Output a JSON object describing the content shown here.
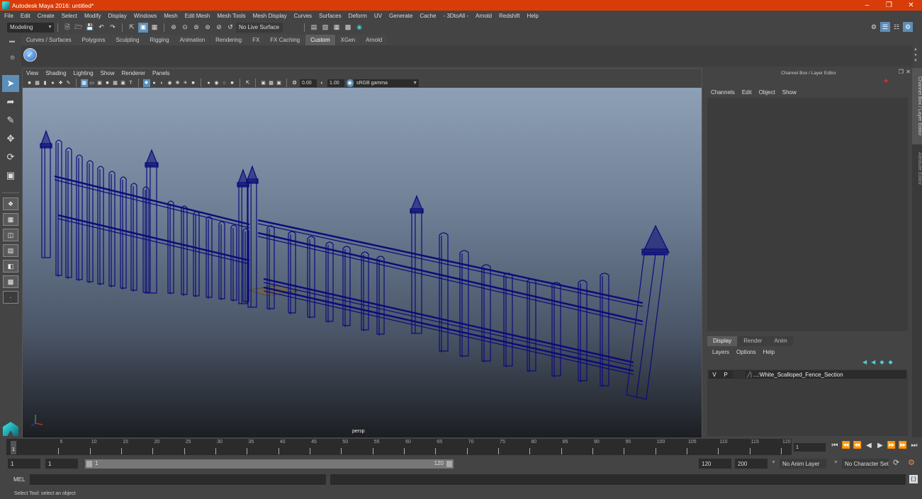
{
  "window": {
    "title": "Autodesk Maya 2016: untitled*",
    "controls": [
      "minimize",
      "maximize",
      "close"
    ]
  },
  "menubar": [
    "File",
    "Edit",
    "Create",
    "Select",
    "Modify",
    "Display",
    "Windows",
    "Mesh",
    "Edit Mesh",
    "Mesh Tools",
    "Mesh Display",
    "Curves",
    "Surfaces",
    "Deform",
    "UV",
    "Generate",
    "Cache",
    "- 3DtoAll -",
    "Arnold",
    "Redshift",
    "Help"
  ],
  "statusline": {
    "menuset": "Modeling",
    "live_surface": "No Live Surface"
  },
  "shelf": {
    "tabs": [
      "Curves / Surfaces",
      "Polygons",
      "Sculpting",
      "Rigging",
      "Animation",
      "Rendering",
      "FX",
      "FX Caching",
      "Custom",
      "XGen",
      "Arnold"
    ],
    "active_tab": "Custom"
  },
  "viewport": {
    "menu": [
      "View",
      "Shading",
      "Lighting",
      "Show",
      "Renderer",
      "Panels"
    ],
    "exposure": "0.00",
    "gamma": "1.00",
    "color_space": "sRGB gamma",
    "camera_label": "persp",
    "wireframe_color": "#0b0b7a"
  },
  "channel_box": {
    "title": "Channel Box / Layer Editor",
    "menu": [
      "Channels",
      "Edit",
      "Object",
      "Show"
    ]
  },
  "layer_editor": {
    "tabs": [
      "Display",
      "Render",
      "Anim"
    ],
    "active_tab": "Display",
    "menu": [
      "Layers",
      "Options",
      "Help"
    ],
    "layers": [
      {
        "v": "V",
        "p": "P",
        "name": "...:White_Scalloped_Fence_Section"
      }
    ]
  },
  "side_tabs": [
    "Channel Box / Layer Editor",
    "Attribute Editor"
  ],
  "timeline": {
    "ticks": [
      "5",
      "10",
      "15",
      "20",
      "25",
      "30",
      "35",
      "40",
      "45",
      "50",
      "55",
      "60",
      "65",
      "70",
      "75",
      "80",
      "85",
      "90",
      "95",
      "100",
      "105",
      "110",
      "115",
      "120"
    ],
    "current_frame": "1",
    "current_frame_field": "1"
  },
  "range": {
    "start": "1",
    "playback_start": "1",
    "slider_start": "1",
    "slider_end": "120",
    "playback_end": "120",
    "end": "200",
    "anim_layer": "No Anim Layer",
    "character_set": "No Character Set"
  },
  "command": {
    "label": "MEL"
  },
  "help_line": "Select Tool: select an object"
}
